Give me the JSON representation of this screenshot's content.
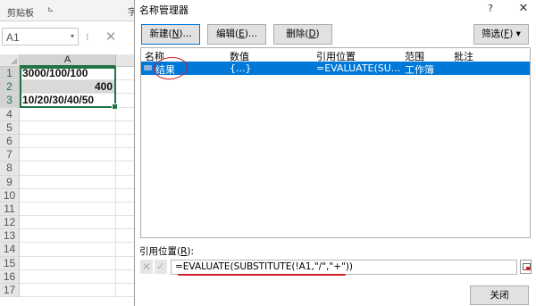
{
  "excel": {
    "ribbon": {
      "clipboard_label": "剪贴板",
      "launcher_glyph": "⊾",
      "partial_label": "字"
    },
    "name_box": {
      "value": "A1",
      "dropdown_glyph": "▾",
      "separator": "⁝",
      "cancel_glyph": "✕"
    },
    "column_header": "A",
    "rows": [
      {
        "n": "1",
        "a": "3000/100/100"
      },
      {
        "n": "2",
        "a": "400"
      },
      {
        "n": "3",
        "a": "10/20/30/40/50"
      },
      {
        "n": "4",
        "a": ""
      },
      {
        "n": "5",
        "a": ""
      },
      {
        "n": "6",
        "a": ""
      },
      {
        "n": "7",
        "a": ""
      },
      {
        "n": "8",
        "a": ""
      },
      {
        "n": "9",
        "a": ""
      },
      {
        "n": "10",
        "a": ""
      },
      {
        "n": "11",
        "a": ""
      },
      {
        "n": "12",
        "a": ""
      },
      {
        "n": "13",
        "a": ""
      },
      {
        "n": "14",
        "a": ""
      },
      {
        "n": "15",
        "a": ""
      },
      {
        "n": "16",
        "a": ""
      },
      {
        "n": "17",
        "a": ""
      }
    ]
  },
  "dialog": {
    "title": "名称管理器",
    "help_glyph": "?",
    "close_glyph": "✕",
    "buttons": {
      "new": {
        "label": "新建(",
        "key": "N",
        "tail": ")..."
      },
      "edit": {
        "label": "编辑(",
        "key": "E",
        "tail": ")..."
      },
      "delete": {
        "label": "删除(",
        "key": "D",
        "tail": ")"
      },
      "filter": {
        "label": "筛选(",
        "key": "F",
        "tail": ") ▾"
      },
      "close": "关闭"
    },
    "columns": [
      "名称",
      "数值",
      "引用位置",
      "范围",
      "批注"
    ],
    "names": [
      {
        "name": "结果",
        "value": "{...}",
        "refers_to": "=EVALUATE(SU...",
        "scope": "工作簿",
        "comment": ""
      }
    ],
    "refers_to_label": {
      "label": "引用位置(",
      "key": "R",
      "tail": "):"
    },
    "refers_to_formula": "=EVALUATE(SUBSTITUTE(!A1,\"/\",\"+\"))",
    "cancel_glyph": "✕",
    "confirm_glyph": "✓",
    "colors": {
      "selection": "#0078d7",
      "annotation": "#d0202a",
      "excel_green": "#217346"
    }
  }
}
